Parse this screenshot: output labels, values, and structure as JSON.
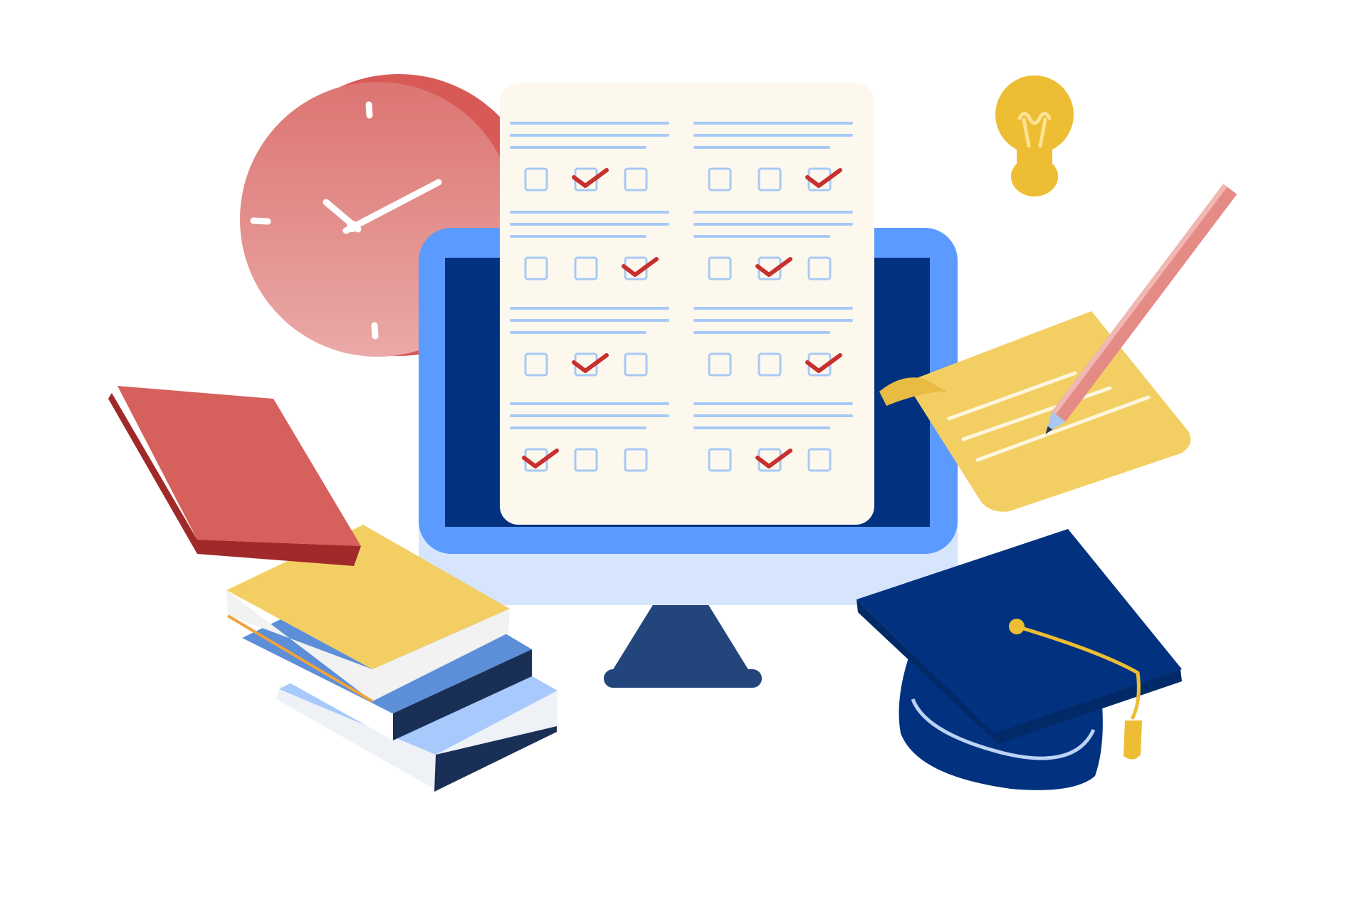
{
  "illustration": {
    "palette": {
      "background": "#ffffff",
      "clock": "#e07a78",
      "clock_shadow": "#d75a57",
      "monitor_frame": "#5b9bff",
      "monitor_screen": "#02327f",
      "monitor_chin": "#d6e5fc",
      "monitor_stand": "#22457c",
      "answer_sheet": "#fcf8ee",
      "answer_line": "#a7c9f5",
      "checkbox_border": "#a7c9f5",
      "checkmark": "#c8302f",
      "lightbulb": "#edbd34",
      "note_paper": "#f3cf63",
      "pencil": "#e58b86",
      "grad_cap": "#02327f",
      "grad_tassel": "#edbd34",
      "book_red": "#d6605c",
      "book_yellow": "#f3cf63",
      "book_blue": "#5d8fd8",
      "book_light_blue": "#a7c9fb"
    },
    "icons": [
      "wall-clock-icon",
      "computer-monitor-icon",
      "answer-sheet-icon",
      "lightbulb-icon",
      "pencil-icon",
      "note-paper-icon",
      "graduation-cap-icon",
      "book-stack-icon"
    ],
    "answer_sheet": {
      "options_per_question": 3,
      "columns": [
        {
          "selected": [
            2,
            3,
            2,
            1
          ]
        },
        {
          "selected": [
            3,
            2,
            3,
            2
          ]
        }
      ]
    }
  }
}
